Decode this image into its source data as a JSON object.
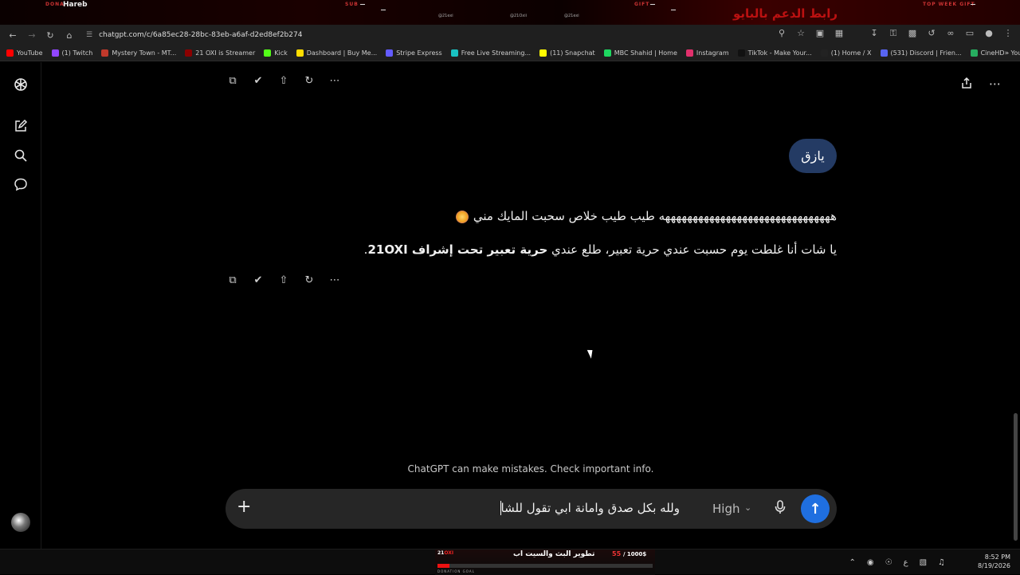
{
  "overlay": {
    "donation_tag": "DONA",
    "donor_name": "Hareb",
    "sub_tag": "SUB",
    "gift_tag": "GIFT",
    "topgift_tag": "TOP WEEK GIFT",
    "instagram": "@21exi",
    "snap": "@21Oxii",
    "tiktok": "@21exi",
    "support_link": "رابط الدعم بالبايو"
  },
  "browser": {
    "url": "chatgpt.com/c/6a85ec28-28bc-83eb-a6af-d2ed8ef2b274",
    "bookmarks": [
      {
        "label": "YouTube",
        "color": "#ff0000"
      },
      {
        "label": "(1) Twitch",
        "color": "#9146ff"
      },
      {
        "label": "Mystery Town - MT...",
        "color": "#c0392b"
      },
      {
        "label": "21 OXI is Streamer",
        "color": "#8b0000"
      },
      {
        "label": "Kick",
        "color": "#53fc18"
      },
      {
        "label": "Dashboard | Buy Me...",
        "color": "#ffdd00"
      },
      {
        "label": "Stripe Express",
        "color": "#635bff"
      },
      {
        "label": "Free Live Streaming...",
        "color": "#19c1c1"
      },
      {
        "label": "(11) Snapchat",
        "color": "#fffc00"
      },
      {
        "label": "MBC Shahid | Home",
        "color": "#1ed760"
      },
      {
        "label": "Instagram",
        "color": "#e1306c"
      },
      {
        "label": "TikTok - Make Your...",
        "color": "#111111"
      },
      {
        "label": "(1) Home / X",
        "color": "#222222"
      },
      {
        "label": "(531) Discord | Frien...",
        "color": "#5865f2"
      },
      {
        "label": "CineHD - Your Ultim...",
        "color": "#27ae60"
      }
    ]
  },
  "chat": {
    "user_message": "يازق",
    "reply_line1": "هههههههههههههههههههههههههههههههه طيب طيب خلاص سحبت المايك مني",
    "reply_line2_normal": "يا شات أنا غلطت يوم حسبت عندي حرية تعبير، طلع عندي ",
    "reply_line2_bold": "حرية تعبير تحت إشراف 21OXI",
    "reply_line2_end": ".",
    "disclaimer": "ChatGPT can make mistakes. Check important info.",
    "composer_text": "ولله بكل صدق وامانة ابي تقول للشا",
    "model": "High"
  },
  "taskbar": {
    "goal_prefix": "21",
    "goal_brand": "OXI",
    "goal_title": "تطوير البث والسيت اب",
    "goal_current": "55",
    "goal_target": "/ 1000$",
    "goal_progress": 0.055,
    "goal_label": "DONATION GOAL",
    "time": "8:52 PM",
    "date": "8/19/2026",
    "lang": "ع"
  }
}
